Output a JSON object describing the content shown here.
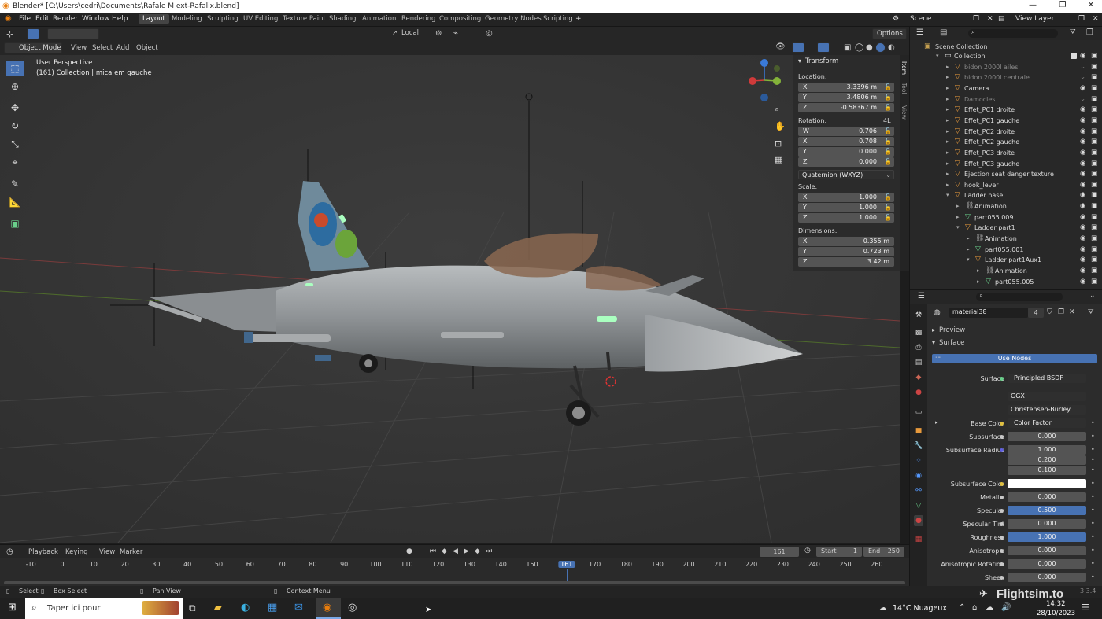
{
  "title_bar": {
    "text": "Blender* [C:\\Users\\cedri\\Documents\\Rafale M ext-Rafalix.blend]"
  },
  "menu": {
    "items": [
      "File",
      "Edit",
      "Render",
      "Window",
      "Help"
    ]
  },
  "workspaces": [
    "Layout",
    "Modeling",
    "Sculpting",
    "UV Editing",
    "Texture Paint",
    "Shading",
    "Animation",
    "Rendering",
    "Compositing",
    "Geometry Nodes",
    "Scripting"
  ],
  "scene": {
    "name": "Scene",
    "view_layer": "View Layer"
  },
  "viewport_header": {
    "mode": "Object Mode",
    "menus": [
      "View",
      "Select",
      "Add",
      "Object"
    ],
    "transform_orientation": "Local",
    "options": "Options"
  },
  "viewport": {
    "perspective": "User Perspective",
    "info": "(161) Collection | mica em gauche"
  },
  "transform": {
    "title": "Transform",
    "location_label": "Location:",
    "location": [
      [
        "X",
        "3.3396 m"
      ],
      [
        "Y",
        "3.4806 m"
      ],
      [
        "Z",
        "-0.58367 m"
      ]
    ],
    "rotation_label": "Rotation:",
    "rotation_mode_tag": "4L",
    "rotation": [
      [
        "W",
        "0.706"
      ],
      [
        "X",
        "0.708"
      ],
      [
        "Y",
        "0.000"
      ],
      [
        "Z",
        "0.000"
      ]
    ],
    "rotation_mode": "Quaternion (WXYZ)",
    "scale_label": "Scale:",
    "scale": [
      [
        "X",
        "1.000"
      ],
      [
        "Y",
        "1.000"
      ],
      [
        "Z",
        "1.000"
      ]
    ],
    "dimensions_label": "Dimensions:",
    "dimensions": [
      [
        "X",
        "0.355 m"
      ],
      [
        "Y",
        "0.723 m"
      ],
      [
        "Z",
        "3.42 m"
      ]
    ]
  },
  "side_tabs": [
    "Item",
    "Tool",
    "View"
  ],
  "outliner": {
    "title": "Scene Collection",
    "rows": [
      {
        "indent": 1,
        "label": "Collection",
        "grey": false,
        "checkbox": true
      },
      {
        "indent": 2,
        "label": "bidon 2000l ailes",
        "grey": true
      },
      {
        "indent": 2,
        "label": "bidon 2000l centrale",
        "grey": true
      },
      {
        "indent": 2,
        "label": "Camera",
        "grey": false
      },
      {
        "indent": 2,
        "label": "Damocles",
        "grey": true
      },
      {
        "indent": 2,
        "label": "Effet_PC1 droite",
        "grey": false
      },
      {
        "indent": 2,
        "label": "Effet_PC1 gauche",
        "grey": false
      },
      {
        "indent": 2,
        "label": "Effet_PC2 droite",
        "grey": false
      },
      {
        "indent": 2,
        "label": "Effet_PC2 gauche",
        "grey": false
      },
      {
        "indent": 2,
        "label": "Effet_PC3 droite",
        "grey": false
      },
      {
        "indent": 2,
        "label": "Effet_PC3 gauche",
        "grey": false
      },
      {
        "indent": 2,
        "label": "Ejection seat danger texture",
        "grey": false
      },
      {
        "indent": 2,
        "label": "hook_lever",
        "grey": false
      },
      {
        "indent": 2,
        "label": "Ladder base",
        "grey": false
      },
      {
        "indent": 3,
        "label": "Animation",
        "grey": false
      },
      {
        "indent": 3,
        "label": "part055.009",
        "grey": false
      },
      {
        "indent": 3,
        "label": "Ladder part1",
        "grey": false
      },
      {
        "indent": 4,
        "label": "Animation",
        "grey": false
      },
      {
        "indent": 4,
        "label": "part055.001",
        "grey": false
      },
      {
        "indent": 4,
        "label": "Ladder part1Aux1",
        "grey": false
      },
      {
        "indent": 5,
        "label": "Animation",
        "grey": false
      },
      {
        "indent": 5,
        "label": "part055.005",
        "grey": false
      }
    ]
  },
  "properties": {
    "material_name": "material38",
    "users": "4",
    "sections": {
      "preview": "Preview",
      "surface": "Surface"
    },
    "use_nodes": "Use Nodes",
    "surface_label": "Surface",
    "surface_value": "Principled BSDF",
    "distribution": "GGX",
    "subsurface_method": "Christensen-Burley",
    "rows": [
      {
        "label": "Base Color",
        "value": "Color Factor",
        "style": "dark"
      },
      {
        "label": "Subsurface",
        "value": "0.000",
        "style": "normal"
      },
      {
        "label": "Subsurface Radius",
        "value": "1.000",
        "style": "normal"
      },
      {
        "label": "",
        "value": "0.200",
        "style": "normal"
      },
      {
        "label": "",
        "value": "0.100",
        "style": "normal"
      },
      {
        "label": "Subsurface Color",
        "value": "",
        "style": "white"
      },
      {
        "label": "Metallic",
        "value": "0.000",
        "style": "normal"
      },
      {
        "label": "Specular",
        "value": "0.500",
        "style": "blue"
      },
      {
        "label": "Specular Tint",
        "value": "0.000",
        "style": "normal"
      },
      {
        "label": "Roughness",
        "value": "1.000",
        "style": "blue"
      },
      {
        "label": "Anisotropic",
        "value": "0.000",
        "style": "normal"
      },
      {
        "label": "Anisotropic Rotation",
        "value": "0.000",
        "style": "normal"
      },
      {
        "label": "Sheen",
        "value": "0.000",
        "style": "normal"
      }
    ]
  },
  "timeline": {
    "menus": [
      "Playback",
      "Keying",
      "View",
      "Marker"
    ],
    "current_frame": "161",
    "start_label": "Start",
    "start": "1",
    "end_label": "End",
    "end": "250",
    "ticks": [
      "-10",
      "0",
      "10",
      "20",
      "30",
      "40",
      "50",
      "60",
      "70",
      "80",
      "90",
      "100",
      "110",
      "120",
      "130",
      "140",
      "150",
      "161",
      "170",
      "180",
      "190",
      "200",
      "210",
      "220",
      "230",
      "240",
      "250",
      "260"
    ]
  },
  "status": {
    "select": "Select",
    "box_select": "Box Select",
    "pan": "Pan View",
    "context": "Context Menu",
    "version": "3.3.4"
  },
  "taskbar": {
    "search_placeholder": "Taper ici pour",
    "weather": "14°C  Nuageux",
    "time": "14:32",
    "date": "28/10/2023",
    "watermark": "Flightsim.to"
  },
  "colors": {
    "accent": "#4772b3",
    "active_frame": "#4772b3",
    "object_orange": "#e89a3c",
    "mesh_green": "#6ad08b"
  }
}
